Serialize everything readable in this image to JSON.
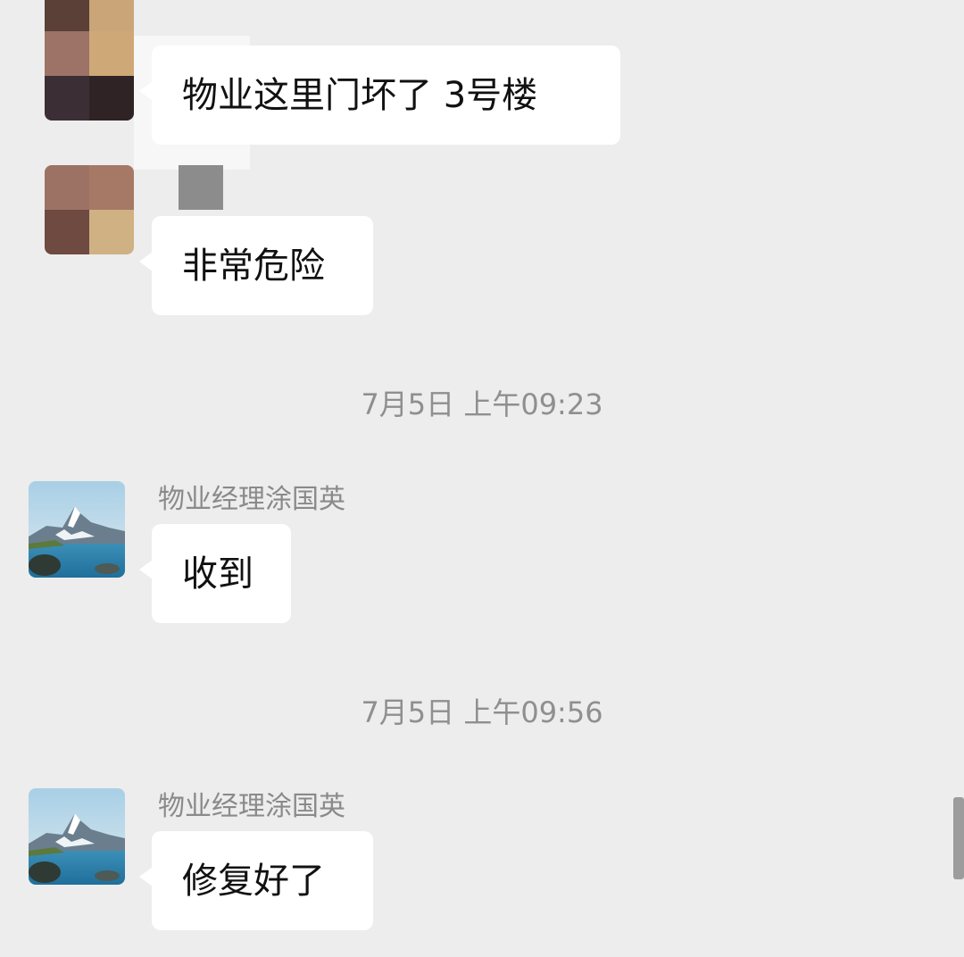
{
  "messages": [
    {
      "sender": "",
      "text": "物业这里门坏了 3号楼"
    },
    {
      "sender": "",
      "text": "非常危险"
    },
    {
      "timestamp": "7月5日 上午09:23",
      "sender": "物业经理涂国英",
      "text": "收到"
    },
    {
      "timestamp": "7月5日 上午09:56",
      "sender": "物业经理涂国英",
      "text": "修复好了"
    }
  ],
  "icons": {
    "manager_avatar": "mountain-lake-avatar-icon",
    "resident_avatar": "pixelated-avatar"
  },
  "colors": {
    "background": "#ededed",
    "bubble": "#ffffff",
    "meta_text": "#8f8f8f"
  }
}
